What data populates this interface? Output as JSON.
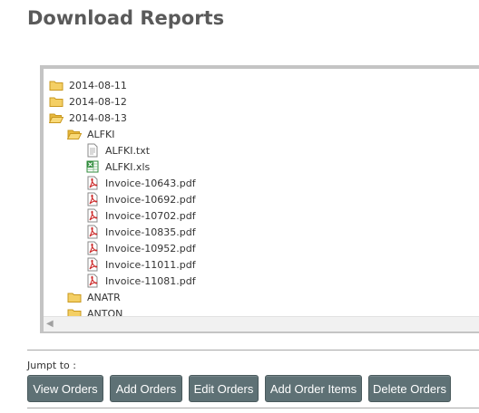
{
  "page": {
    "title": "Download Reports"
  },
  "tree": {
    "items": [
      {
        "label": "2014-08-11",
        "type": "folder-closed"
      },
      {
        "label": "2014-08-12",
        "type": "folder-closed"
      },
      {
        "label": "2014-08-13",
        "type": "folder-open"
      },
      {
        "label": "ALFKI",
        "type": "folder-open"
      },
      {
        "label": "ALFKI.txt",
        "type": "file-txt"
      },
      {
        "label": "ALFKI.xls",
        "type": "file-xls"
      },
      {
        "label": "Invoice-10643.pdf",
        "type": "file-pdf"
      },
      {
        "label": "Invoice-10692.pdf",
        "type": "file-pdf"
      },
      {
        "label": "Invoice-10702.pdf",
        "type": "file-pdf"
      },
      {
        "label": "Invoice-10835.pdf",
        "type": "file-pdf"
      },
      {
        "label": "Invoice-10952.pdf",
        "type": "file-pdf"
      },
      {
        "label": "Invoice-11011.pdf",
        "type": "file-pdf"
      },
      {
        "label": "Invoice-11081.pdf",
        "type": "file-pdf"
      },
      {
        "label": "ANATR",
        "type": "folder-closed"
      },
      {
        "label": "ANTON",
        "type": "folder-closed"
      }
    ]
  },
  "jump": {
    "label": "Jumpt to :",
    "buttons": [
      "View Orders",
      "Add Orders",
      "Edit Orders",
      "Add Order Items",
      "Delete Orders"
    ]
  },
  "colors": {
    "button_bg": "#5e7175",
    "title": "#5a5a5a",
    "folder": "#f0c24a",
    "pdf": "#cc2a2a",
    "xls": "#2e8b3a"
  }
}
